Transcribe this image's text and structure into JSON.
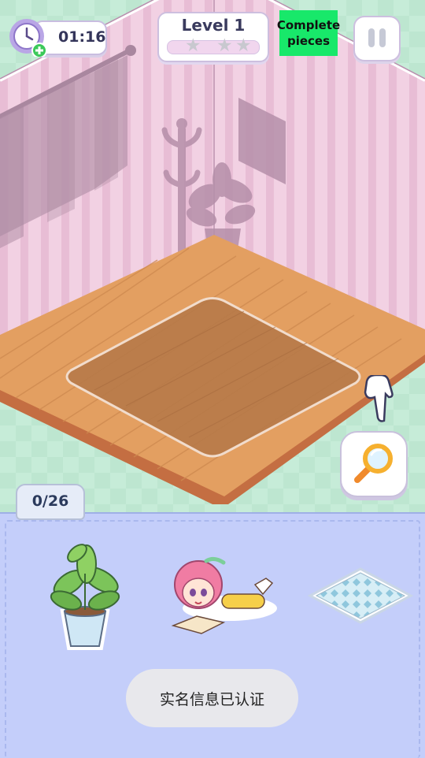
{
  "hud": {
    "timer": "01:16",
    "level_label": "Level 1",
    "stars_total": 3,
    "stars_filled": 0,
    "complete_label": "Complete pieces",
    "complete_line1": "Complete",
    "complete_line2": "pieces"
  },
  "tray": {
    "counter": "0/26",
    "pieces": [
      "potted-plant",
      "reading-girl",
      "patterned-rug"
    ]
  },
  "toast": {
    "message": "实名信息已认证"
  },
  "icons": [
    "clock-icon",
    "add-time-icon",
    "star-icon",
    "pause-icon",
    "magnifier-icon",
    "pointer-hand-icon"
  ],
  "colors": {
    "wall": "#f1cfe2",
    "wall_stripe": "#e7bcd4",
    "floor": "#e09b5c",
    "floor_edge": "#c46e42",
    "complete_button": "#18e86a",
    "tray": "#c4cefa",
    "background": "#bfe8d2"
  }
}
